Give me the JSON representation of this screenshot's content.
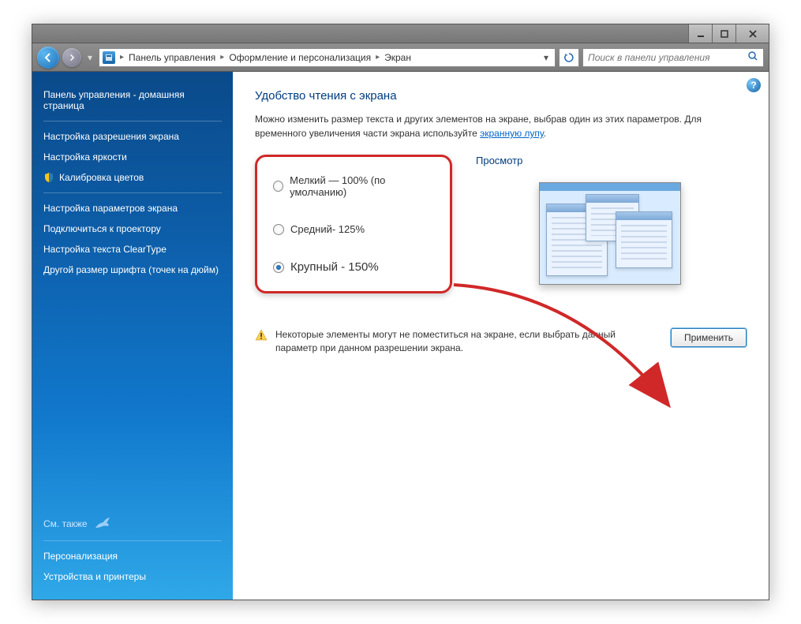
{
  "titlebar": {},
  "breadcrumb": {
    "item1": "Панель управления",
    "item2": "Оформление и персонализация",
    "item3": "Экран"
  },
  "search": {
    "placeholder": "Поиск в панели управления"
  },
  "sidebar": {
    "home": "Панель управления - домашняя страница",
    "links": {
      "0": "Настройка разрешения экрана",
      "1": "Настройка яркости",
      "2": "Калибровка цветов",
      "3": "Настройка параметров экрана",
      "4": "Подключиться к проектору",
      "5": "Настройка текста ClearType",
      "6": "Другой размер шрифта (точек на дюйм)"
    },
    "see_also_label": "См. также",
    "see_also": {
      "0": "Персонализация",
      "1": "Устройства и принтеры"
    }
  },
  "content": {
    "heading": "Удобство чтения с экрана",
    "description_1": "Можно изменить размер текста и других элементов на экране, выбрав один из этих параметров. Для временного увеличения части экрана используйте ",
    "description_link": "экранную лупу",
    "description_2": ".",
    "options": {
      "0": "Мелкий — 100% (по умолчанию)",
      "1": "Средний- 125%",
      "2": "Крупный - 150%"
    },
    "preview_label": "Просмотр",
    "warning_text": "Некоторые элементы могут не поместиться на экране, если выбрать данный параметр при данном разрешении экрана.",
    "apply_label": "Применить"
  }
}
